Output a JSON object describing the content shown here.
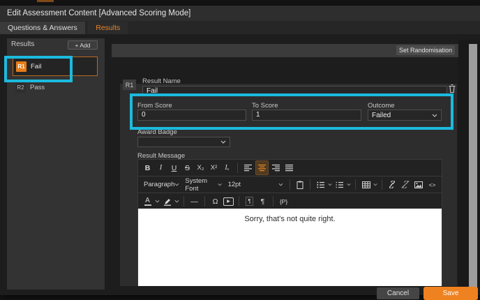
{
  "colors": {
    "accent": "#ee8220",
    "highlight_box": "#1cbade"
  },
  "window": {
    "title": "Edit Assessment Content [Advanced Scoring Mode]"
  },
  "tabs": {
    "questions": "Questions & Answers",
    "results": "Results"
  },
  "sidebar": {
    "header": "Results",
    "add_button": "+ Add",
    "items": [
      {
        "badge": "R1",
        "label": "Fail",
        "selected": true
      },
      {
        "badge": "R2",
        "label": "Pass",
        "selected": false
      }
    ]
  },
  "main": {
    "set_randomisation": "Set Randomisation",
    "result": {
      "badge": "R1",
      "name_label": "Result Name",
      "name_value": "Fail",
      "from_label": "From Score",
      "from_value": "0",
      "to_label": "To Score",
      "to_value": "1",
      "outcome_label": "Outcome",
      "outcome_value": "Failed",
      "award_label": "Award Badge",
      "award_value": "",
      "message_label": "Result Message",
      "message_text": "Sorry, that's not quite right."
    }
  },
  "editor": {
    "paragraph": "Paragraph",
    "font": "System Font",
    "size": "12pt",
    "toolbar": {
      "bold": "B",
      "italic": "I",
      "underline": "U",
      "strike": "S",
      "subscript": "X₂",
      "superscript": "X²",
      "clear": "Iₓ",
      "color_letter": "A",
      "hr": "—",
      "omega": "Ω",
      "pilcrow": "¶",
      "placeholder": "{P}",
      "code": "<>"
    }
  },
  "footer": {
    "cancel": "Cancel",
    "save": "Save"
  }
}
